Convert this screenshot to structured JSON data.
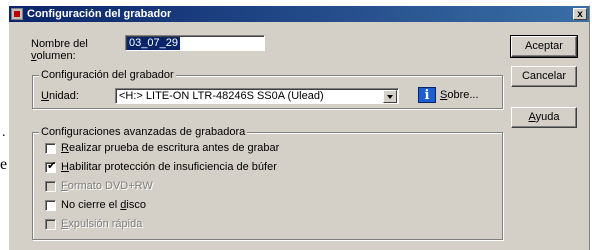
{
  "window": {
    "title": "Configuración del grabador",
    "close_glyph": "x"
  },
  "volume": {
    "label_line1": "Nombre del",
    "label_line2": "volumen:",
    "value": "03_07_29"
  },
  "recorder_group": {
    "legend": "Configuración del grabador",
    "unit_label": "Unidad:",
    "unit_value": "<H:>  LITE-ON LTR-48246S  SS0A (Ulead)",
    "about_label": "Sobre..."
  },
  "advanced_group": {
    "legend": "Configuraciones avanzadas de grabadora",
    "options": [
      {
        "label": "Realizar prueba de escritura antes de grabar",
        "checked": false,
        "enabled": true
      },
      {
        "label": "Habilitar protección de insuficiencia de búfer",
        "checked": true,
        "enabled": true
      },
      {
        "label": "Formato DVD+RW",
        "checked": false,
        "enabled": false
      },
      {
        "label": "No cierre el disco",
        "checked": false,
        "enabled": true
      },
      {
        "label": "Expulsión rápida",
        "checked": false,
        "enabled": false
      }
    ]
  },
  "buttons": {
    "accept": "Aceptar",
    "cancel": "Cancelar",
    "help": "Ayuda"
  },
  "background_fragments": {
    "dot": ".",
    "e": "e"
  },
  "icons": {
    "window_icon": "recorder-app-icon",
    "info": "info-icon",
    "dropdown": "chevron-down-icon",
    "checkmark": "checkmark-icon"
  }
}
